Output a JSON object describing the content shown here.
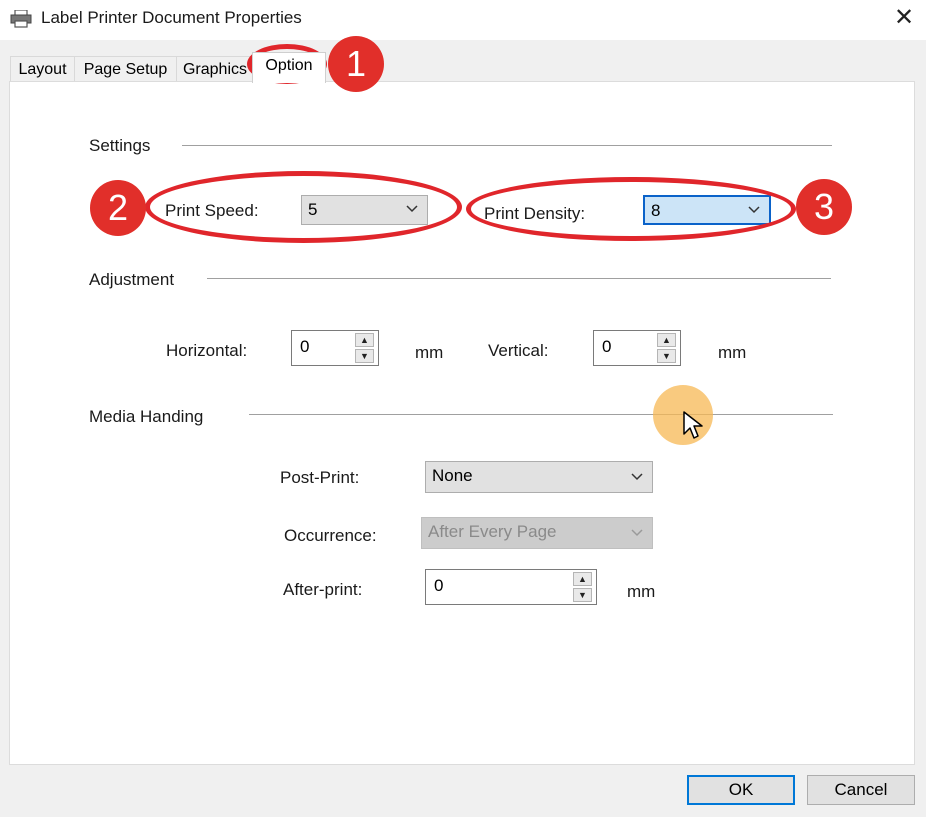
{
  "window": {
    "title": "Label Printer Document Properties",
    "close_glyph": "✕"
  },
  "tabs": [
    {
      "label": "Layout"
    },
    {
      "label": "Page Setup"
    },
    {
      "label": "Graphics"
    },
    {
      "label": "Option",
      "selected": true
    }
  ],
  "settings": {
    "section_label": "Settings",
    "print_speed": {
      "label": "Print Speed:",
      "value": "5"
    },
    "print_density": {
      "label": "Print Density:",
      "value": "8"
    }
  },
  "adjustment": {
    "section_label": "Adjustment",
    "horizontal": {
      "label": "Horizontal:",
      "value": "0",
      "unit": "mm"
    },
    "vertical": {
      "label": "Vertical:",
      "value": "0",
      "unit": "mm"
    }
  },
  "media_handling": {
    "section_label": "Media Handing",
    "post_print": {
      "label": "Post-Print:",
      "value": "None"
    },
    "occurrence": {
      "label": "Occurrence:",
      "value": "After Every Page",
      "disabled": true
    },
    "after_print": {
      "label": "After-print:",
      "value": "0",
      "unit": "mm"
    }
  },
  "buttons": {
    "ok": "OK",
    "cancel": "Cancel"
  },
  "annotations": {
    "step1": "1",
    "step2": "2",
    "step3": "3",
    "color": "#e0262b"
  },
  "icons": {
    "window": "printer-icon",
    "close": "close-icon",
    "dropdown": "chevron-down-icon",
    "pointer": "mouse-cursor-icon"
  }
}
